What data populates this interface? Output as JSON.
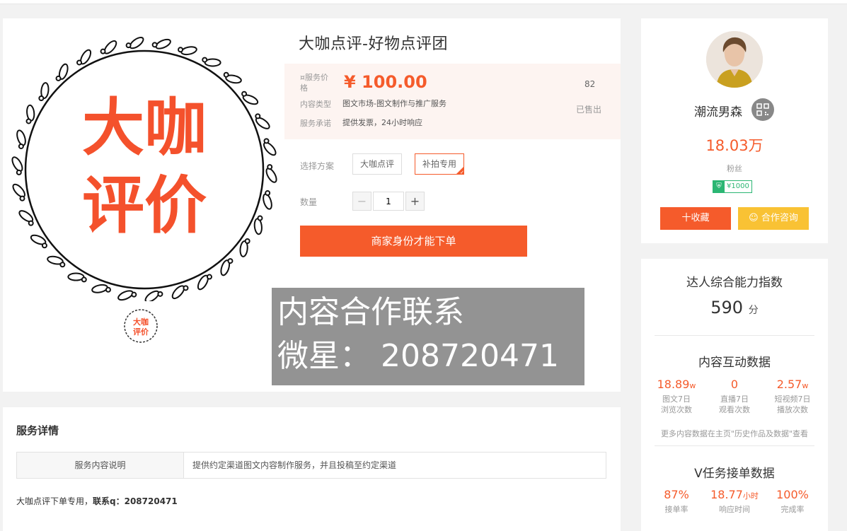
{
  "product": {
    "title": "大咖点评-好物点评团",
    "image_text": [
      "大咖",
      "评价"
    ],
    "thumb_text": [
      "大咖",
      "评价"
    ],
    "price_label": "¤服务价格",
    "price": "¥ 100.00",
    "sold_count": "82",
    "sold_label": "已售出",
    "type_label": "内容类型",
    "type_value": "图文市场-图文制作与推广服务",
    "promise_label": "服务承诺",
    "promise_value": "提供发票，24小时响应",
    "plan_label": "选择方案",
    "plans": [
      "大咖点评",
      "补拍专用"
    ],
    "qty_label": "数量",
    "qty_minus": "−",
    "qty_value": "1",
    "qty_plus": "+",
    "order_button": "商家身份才能下单"
  },
  "watermark": {
    "line1": "内容合作联系",
    "line2": "微星： 208720471"
  },
  "service": {
    "title": "服务详情",
    "key": "服务内容说明",
    "value": "提供约定渠道图文内容制作服务，并且投稿至约定渠道",
    "note_prefix": "大咖点评下单专用，",
    "note_bold": "联系q：208720471"
  },
  "profile": {
    "name": "潮流男森",
    "fans": "18.03万",
    "fans_label": "粉丝",
    "badge_icon": "shield-icon",
    "badge": "¥1000",
    "fav_button": "十收藏",
    "consult_button": "合作咨询"
  },
  "ability": {
    "title": "达人综合能力指数",
    "score": "590",
    "score_unit": "分",
    "interaction_title": "内容互动数据",
    "interaction": [
      {
        "value": "18.89",
        "unit": "w",
        "label1": "图文7日",
        "label2": "浏览次数"
      },
      {
        "value": "0",
        "unit": "",
        "label1": "直播7日",
        "label2": "观看次数"
      },
      {
        "value": "2.57",
        "unit": "w",
        "label1": "短视频7日",
        "label2": "播放次数"
      }
    ],
    "more_text": "更多内容数据在主页\"历史作品及数据\"查看",
    "task_title": "V任务接单数据",
    "task": [
      {
        "value": "87%",
        "unit": "",
        "label1": "接单率"
      },
      {
        "value": "18.77",
        "unit": "小时",
        "label1": "响应时间"
      },
      {
        "value": "100%",
        "unit": "",
        "label1": "完成率"
      }
    ]
  },
  "colors": {
    "accent": "#f55b2b",
    "consult": "#f9c234",
    "badge_green": "#2bb673"
  }
}
